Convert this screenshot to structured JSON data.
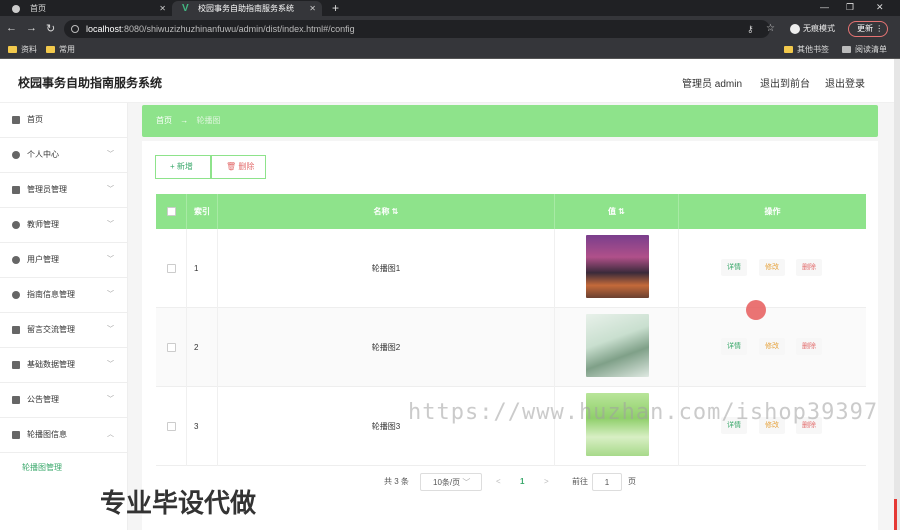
{
  "browser": {
    "tabs": [
      {
        "label": "首页"
      },
      {
        "label": "校园事务自助指南服务系统"
      }
    ],
    "url_host": "localhost",
    "url_rest": ":8080/shiwuzizhuzhinanfuwu/admin/dist/index.html#/config",
    "profile_label": "无痕模式",
    "update_label": "更新",
    "bookmarks": [
      "资料",
      "常用"
    ],
    "bookmarks_right": [
      "其他书签",
      "阅读清单"
    ]
  },
  "header": {
    "title": "校园事务自助指南服务系统",
    "admin_label": "管理员 admin",
    "front_link": "退出到前台",
    "logout_link": "退出登录"
  },
  "sidebar": {
    "items": [
      {
        "label": "首页",
        "icon": "home-icon"
      },
      {
        "label": "个人中心",
        "icon": "user-icon"
      },
      {
        "label": "管理员管理",
        "icon": "admin-icon"
      },
      {
        "label": "教师管理",
        "icon": "teacher-icon"
      },
      {
        "label": "用户管理",
        "icon": "users-icon"
      },
      {
        "label": "指南信息管理",
        "icon": "guide-icon"
      },
      {
        "label": "留言交流管理",
        "icon": "message-icon"
      },
      {
        "label": "基础数据管理",
        "icon": "data-icon"
      },
      {
        "label": "公告管理",
        "icon": "notice-icon"
      },
      {
        "label": "轮播图信息",
        "icon": "carousel-icon"
      }
    ],
    "sub_item": "轮播图管理"
  },
  "breadcrumb": {
    "home": "首页",
    "arrow": "→",
    "current": "轮播图"
  },
  "toolbar": {
    "add_label": "+ 新增",
    "delete_label": "删除"
  },
  "table": {
    "headers": [
      "索引",
      "名称",
      "值",
      "操作"
    ],
    "rows": [
      {
        "index": "1",
        "name": "轮播图1"
      },
      {
        "index": "2",
        "name": "轮播图2"
      },
      {
        "index": "3",
        "name": "轮播图3"
      }
    ],
    "actions": {
      "detail": "详情",
      "edit": "修改",
      "delete": "删除"
    }
  },
  "pagination": {
    "total": "共 3 条",
    "page_size": "10条/页",
    "prev": "<",
    "current_page": "1",
    "next": ">",
    "goto_label": "前往",
    "goto_value": "1",
    "page_suffix": "页"
  },
  "overlay": {
    "watermark": "https://www.huzhan.com/ishop39397",
    "promo": "专业毕设代做"
  },
  "colors": {
    "accent": "#8ee38b",
    "accent_text": "#3aa86b",
    "danger": "#e36d6d",
    "warning": "#e6a23c"
  }
}
